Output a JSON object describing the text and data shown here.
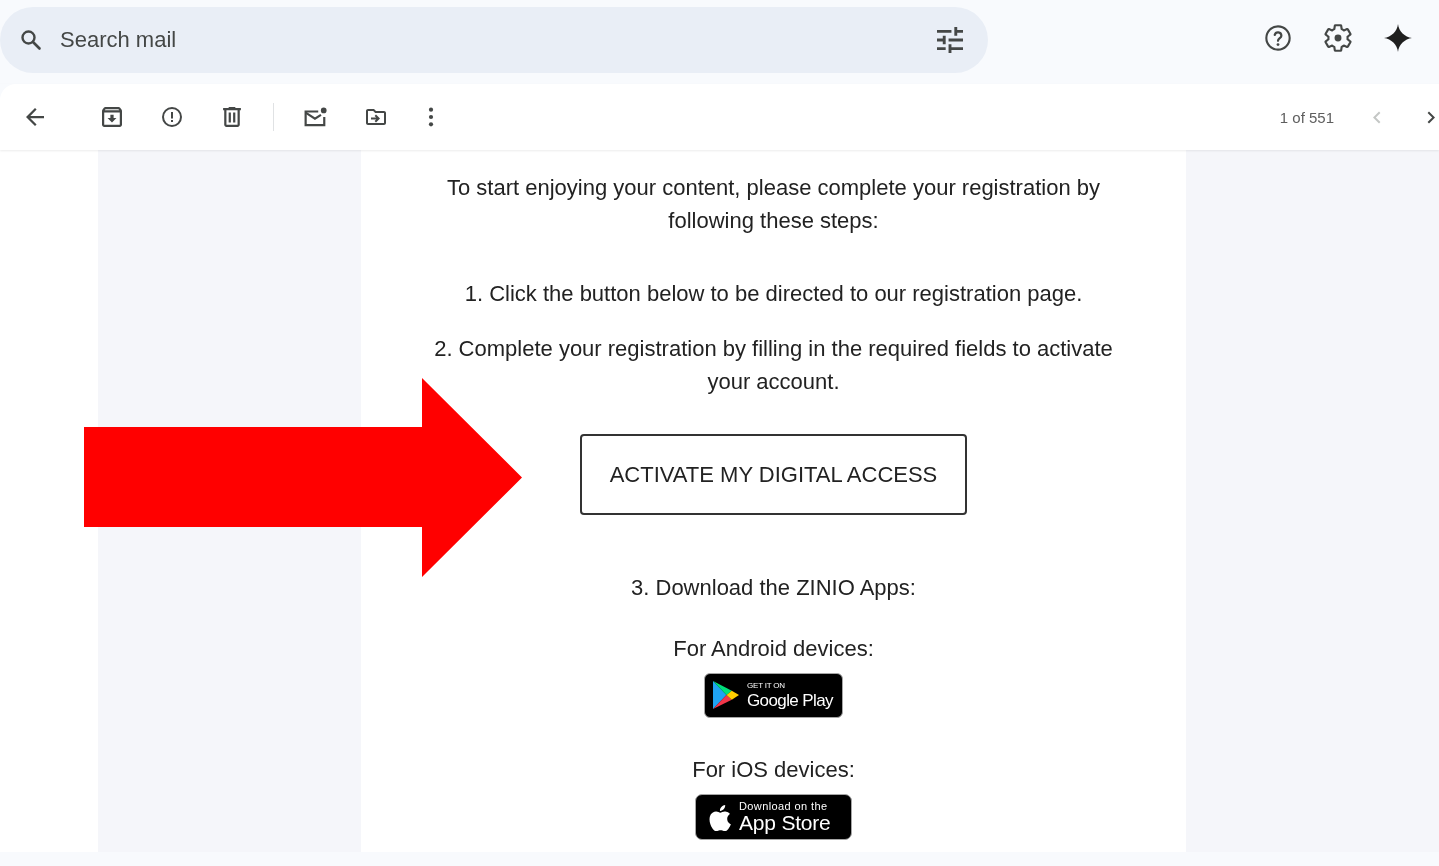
{
  "search": {
    "placeholder": "Search mail"
  },
  "pager": {
    "text": "1 of 551",
    "buttons": [
      {
        "kind": "previous",
        "disabled": true
      },
      {
        "kind": "next",
        "disabled": false
      }
    ]
  },
  "email": {
    "intro": "To start enjoying your content, please complete your registration by following these steps:",
    "steps": [
      "1. Click the button below to be directed to our registration page.",
      "2. Complete your registration by filling in the required fields to activate your account."
    ],
    "cta": {
      "label": "ACTIVATE MY DIGITAL ACCESS"
    },
    "apps_heading": "3. Download the ZINIO Apps:",
    "platforms": [
      {
        "label": "For Android devices:",
        "badge": {
          "kind": "google_play",
          "small_text": "GET IT ON",
          "large_text": "Google Play"
        }
      },
      {
        "label": "For iOS devices:",
        "badge": {
          "kind": "app_store",
          "small_text": "Download on the",
          "large_text": "App Store"
        }
      }
    ]
  }
}
